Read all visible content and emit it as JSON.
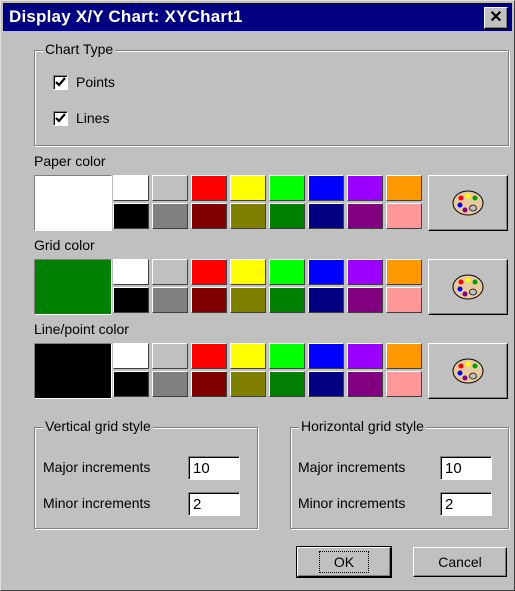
{
  "window": {
    "title": "Display X/Y Chart: XYChart1",
    "close_glyph": "✕"
  },
  "chart_type": {
    "label": "Chart Type",
    "points_label": "Points",
    "points_checked": true,
    "lines_label": "Lines",
    "lines_checked": true
  },
  "paper_color": {
    "label": "Paper color",
    "current": "#ffffff"
  },
  "grid_color": {
    "label": "Grid color",
    "current": "#008000"
  },
  "line_color": {
    "label": "Line/point color",
    "current": "#000000"
  },
  "palette": {
    "top": [
      "#ffffff",
      "#c0c0c0",
      "#ff0000",
      "#ffff00",
      "#00ff00",
      "#0000ff",
      "#9900ff",
      "#ff9900"
    ],
    "bottom": [
      "#000000",
      "#808080",
      "#800000",
      "#808000",
      "#008000",
      "#000080",
      "#800080",
      "#ff9999"
    ],
    "custom_icon": "palette-icon"
  },
  "vertical_grid": {
    "label": "Vertical grid style",
    "major_label": "Major increments",
    "major_value": "10",
    "minor_label": "Minor increments",
    "minor_value": "2"
  },
  "horizontal_grid": {
    "label": "Horizontal grid style",
    "major_label": "Major increments",
    "major_value": "10",
    "minor_label": "Minor increments",
    "minor_value": "2"
  },
  "buttons": {
    "ok": "OK",
    "cancel": "Cancel"
  }
}
